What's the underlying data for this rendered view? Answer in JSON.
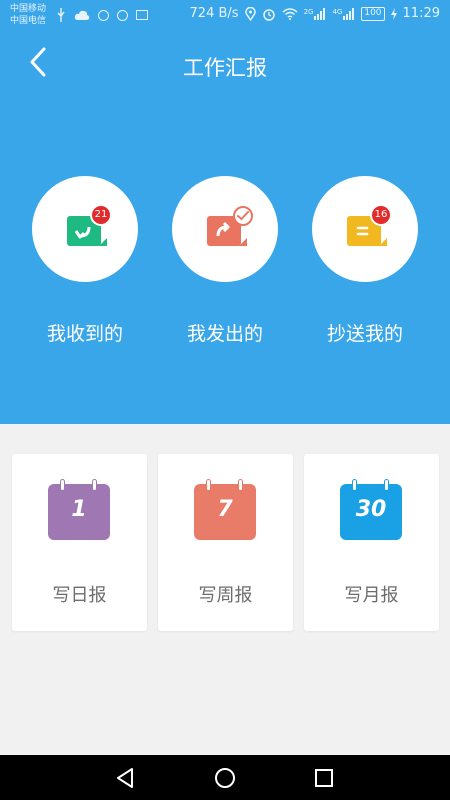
{
  "status_bar": {
    "carrier_1": "中国移动",
    "carrier_2": "中国电信",
    "net_speed": "724 B/s",
    "net_2g": "2G",
    "net_4g": "4G",
    "battery": "100",
    "time": "11:29"
  },
  "header": {
    "title": "工作汇报"
  },
  "actions": [
    {
      "label": "我收到的",
      "badge": "21",
      "color": "#1fba82"
    },
    {
      "label": "我发出的",
      "badge": "",
      "color": "#e97560"
    },
    {
      "label": "抄送我的",
      "badge": "16",
      "color": "#f1b81f"
    }
  ],
  "cards": [
    {
      "label": "写日报",
      "number": "1",
      "color": "#9e77b3"
    },
    {
      "label": "写周报",
      "number": "7",
      "color": "#e97b69"
    },
    {
      "label": "写月报",
      "number": "30",
      "color": "#1aa0e4"
    }
  ],
  "colors": {
    "header_bg": "#3aa6ea",
    "page_bg": "#f1f1f1",
    "badge_red": "#e22b2b"
  }
}
